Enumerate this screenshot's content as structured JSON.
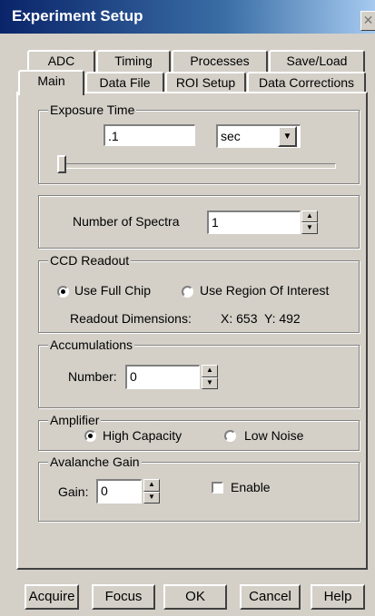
{
  "window": {
    "title": "Experiment Setup",
    "close_glyph": "✕"
  },
  "tabs_back": [
    "ADC",
    "Timing",
    "Processes",
    "Save/Load"
  ],
  "tabs_front": [
    "Main",
    "Data File",
    "ROI Setup",
    "Data Corrections"
  ],
  "exposure": {
    "legend": "Exposure Time",
    "value": ".1",
    "unit": "sec",
    "slider_fraction": 0.0
  },
  "spectra": {
    "label": "Number of Spectra",
    "value": "1"
  },
  "ccd_readout": {
    "legend": "CCD Readout",
    "option_full": "Use Full Chip",
    "option_roi": "Use Region Of Interest",
    "selected": "full",
    "dimensions_label": "Readout Dimensions:",
    "dimensions_value": "X: 653  Y: 492"
  },
  "accumulations": {
    "legend": "Accumulations",
    "label": "Number:",
    "value": "0"
  },
  "amplifier": {
    "legend": "Amplifier",
    "option_high": "High Capacity",
    "option_low": "Low Noise",
    "selected": "high"
  },
  "avalanche": {
    "legend": "Avalanche Gain",
    "label": "Gain:",
    "value": "0",
    "enable_label": "Enable",
    "enabled": false
  },
  "buttons": {
    "acquire": "Acquire",
    "focus": "Focus",
    "ok": "OK",
    "cancel": "Cancel",
    "help": "Help"
  }
}
